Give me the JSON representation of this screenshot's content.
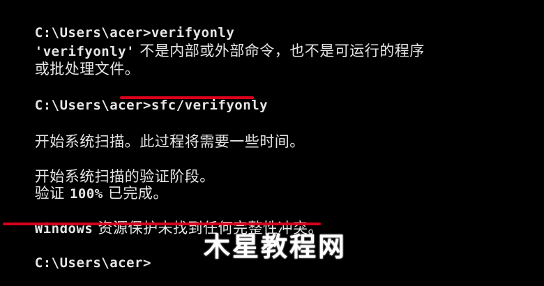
{
  "console": {
    "lines": [
      {
        "kind": "prompt",
        "prompt": "C:\\Users\\acer>",
        "command": "verifyonly"
      },
      {
        "kind": "text",
        "ascii": "'verifyonly'",
        "cjk": " 不是内部或外部命令，也不是可运行的程序"
      },
      {
        "kind": "text",
        "ascii": "",
        "cjk": "或批处理文件。"
      },
      {
        "kind": "prompt",
        "prompt": "C:\\Users\\acer>",
        "command": "sfc/verifyonly"
      },
      {
        "kind": "text",
        "ascii": "",
        "cjk": "开始系统扫描。此过程将需要一些时间。"
      },
      {
        "kind": "text",
        "ascii": "",
        "cjk": "开始系统扫描的验证阶段。"
      },
      {
        "kind": "text",
        "ascii": "",
        "cjk": "验证 "
      },
      {
        "kind": "text",
        "ascii": "Windows",
        "cjk": " 资源保护未找到任何完整性冲突。"
      },
      {
        "kind": "prompt",
        "prompt": "C:\\Users\\acer>",
        "command": ""
      }
    ],
    "verify_progress": "100%",
    "verify_tail": " 已完成。",
    "cursor_glyph": "_"
  },
  "watermark": {
    "text": "木星教程网"
  },
  "colors": {
    "background": "#000000",
    "text": "#e6e6e6",
    "highlight": "#d9001b"
  }
}
